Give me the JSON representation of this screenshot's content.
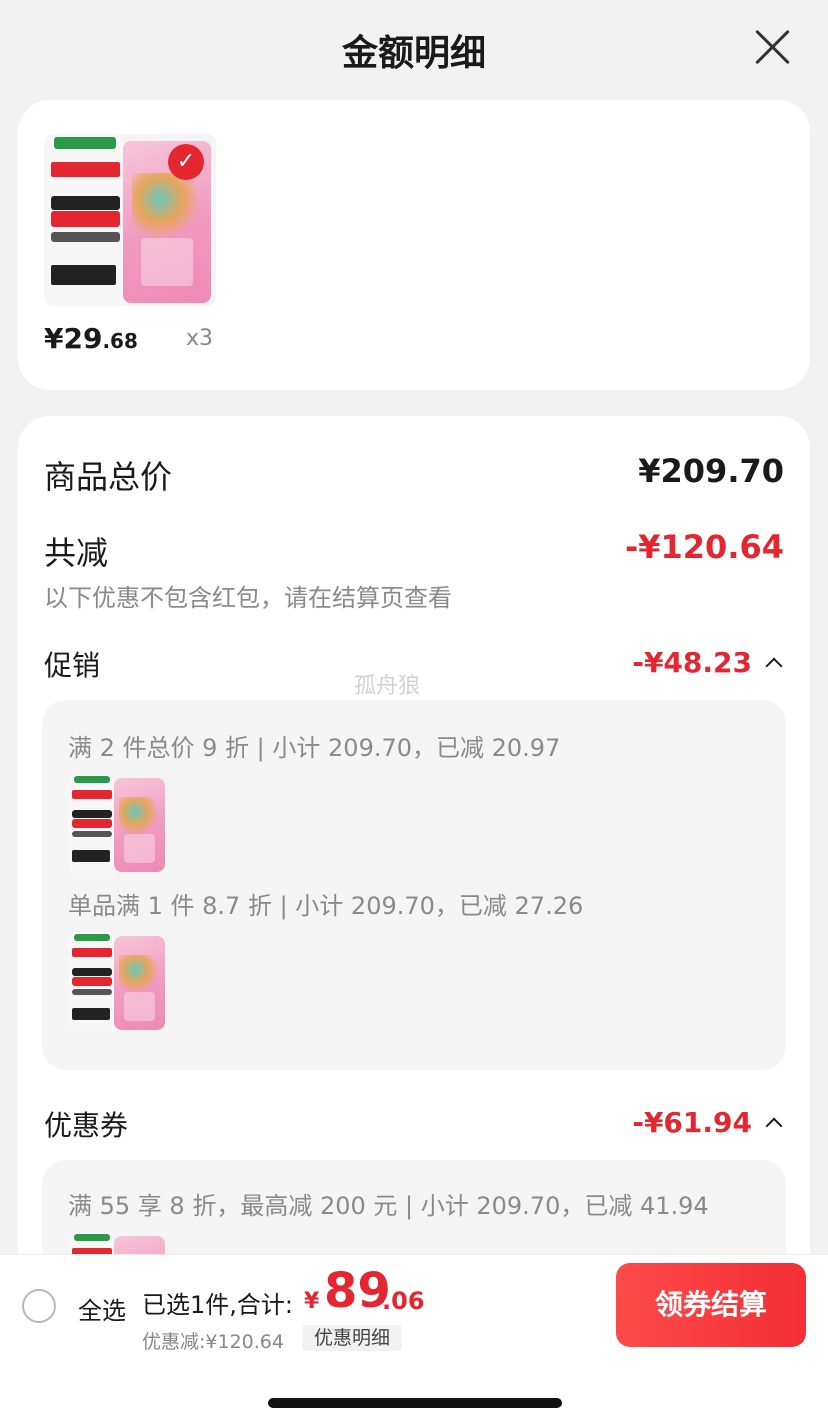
{
  "header": {
    "title": "金额明细"
  },
  "product": {
    "price_int": "¥29",
    "price_dec": ".68",
    "quantity": "x3"
  },
  "summary": {
    "total_label": "商品总价",
    "total_value": "¥209.70",
    "reduce_label": "共减",
    "reduce_value": "-¥120.64",
    "note": "以下优惠不包含红包，请在结算页查看"
  },
  "promotion": {
    "label": "促销",
    "value": "-¥48.23",
    "items": [
      "满 2 件总价 9 折 | 小计 209.70，已减 20.97",
      "单品满 1 件 8.7 折 | 小计 209.70，已减 27.26"
    ]
  },
  "coupon": {
    "label": "优惠券",
    "value": "-¥61.94",
    "items": [
      "满 55 享 8 折，最高减 200 元 | 小计 209.70，已减 41.94"
    ]
  },
  "watermark": "孤舟狼",
  "bottom": {
    "select_all": "全选",
    "selected_text": "已选1件,合计:",
    "currency": "¥",
    "total_int": "89",
    "total_dec": ".06",
    "discount": "优惠减:¥120.64",
    "detail_chip": "优惠明细",
    "checkout": "领券结算"
  },
  "colors": {
    "accent_red": "#e3262f",
    "background": "#f2f2f2"
  }
}
